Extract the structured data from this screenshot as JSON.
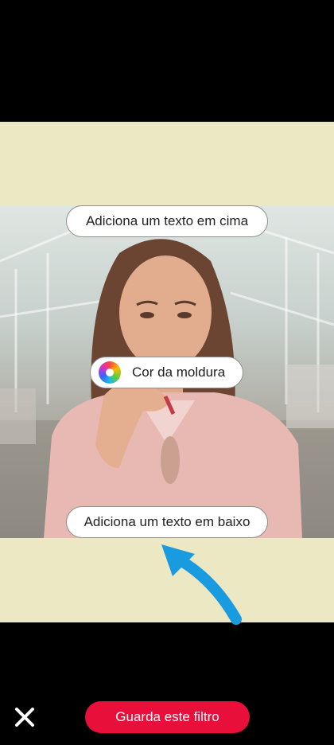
{
  "overlay": {
    "top_text_button": "Adiciona um texto em cima",
    "frame_color_button": "Cor da moldura",
    "bottom_text_button": "Adiciona um texto em baixo"
  },
  "footer": {
    "save_button": "Guarda este filtro"
  },
  "icons": {
    "close": "close-icon",
    "color_wheel": "color-wheel-icon",
    "arrow": "arrow-up-icon"
  },
  "colors": {
    "frame": "#ebe8c3",
    "accent": "#e8103a",
    "arrow": "#1a9be0",
    "background": "#000000"
  }
}
